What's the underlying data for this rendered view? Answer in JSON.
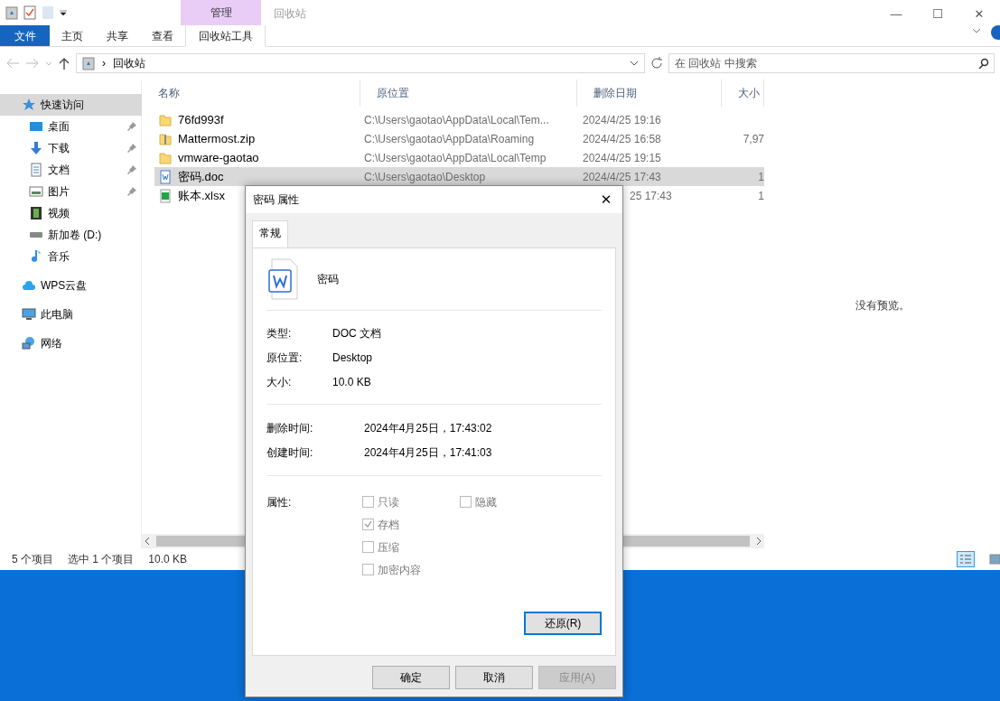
{
  "window": {
    "title": "回收站",
    "context_tab": "管理",
    "minimize": "—",
    "maximize": "☐",
    "close": "✕"
  },
  "ribbon_tabs": [
    {
      "label": "文件",
      "kind": "file",
      "selected": false
    },
    {
      "label": "主页",
      "kind": "plain",
      "selected": false
    },
    {
      "label": "共享",
      "kind": "plain",
      "selected": false
    },
    {
      "label": "查看",
      "kind": "plain",
      "selected": false
    },
    {
      "label": "回收站工具",
      "kind": "context",
      "selected": true
    }
  ],
  "address": {
    "crumb": "回收站",
    "separator": "›"
  },
  "search": {
    "placeholder": "在 回收站 中搜索"
  },
  "sidebar": [
    {
      "label": "快速访问",
      "selected": true,
      "children": [
        {
          "label": "桌面",
          "pinned": true
        },
        {
          "label": "下载",
          "pinned": true
        },
        {
          "label": "文档",
          "pinned": true
        },
        {
          "label": "图片",
          "pinned": true
        },
        {
          "label": "视频",
          "pinned": false
        },
        {
          "label": "新加卷 (D:)",
          "pinned": false
        },
        {
          "label": "音乐",
          "pinned": false
        }
      ]
    },
    {
      "label": "WPS云盘",
      "selected": false
    },
    {
      "label": "此电脑",
      "selected": false
    },
    {
      "label": "网络",
      "selected": false
    }
  ],
  "table": {
    "columns": [
      "名称",
      "原位置",
      "删除日期",
      "大小"
    ],
    "rows": [
      {
        "kind": "folder",
        "name": "76fd993f",
        "location": "C:\\Users\\gaotao\\AppData\\Local\\Tem...",
        "date": "2024/4/25 19:16",
        "selected": false
      },
      {
        "kind": "zip",
        "name": "Mattermost.zip",
        "location": "C:\\Users\\gaotao\\AppData\\Roaming",
        "date": "2024/4/25 16:58",
        "size": "7,97",
        "selected": false
      },
      {
        "kind": "folder",
        "name": "vmware-gaotao",
        "location": "C:\\Users\\gaotao\\AppData\\Local\\Temp",
        "date": "2024/4/25 19:15",
        "selected": false
      },
      {
        "kind": "doc",
        "name": "密码.doc",
        "location": "C:\\Users\\gaotao\\Desktop",
        "date": "2024/4/25 17:43",
        "size": "1",
        "selected": true
      },
      {
        "kind": "xlsx",
        "name": "账本.xlsx",
        "date": "25 17:43",
        "size": "1",
        "selected": false
      }
    ]
  },
  "preview": {
    "message": "没有预览。"
  },
  "status_bar": {
    "count": "5 个项目",
    "selection": "选中 1 个项目",
    "size": "10.0 KB"
  },
  "dialog": {
    "title": "密码 属性",
    "close": "✕",
    "tabs": [
      {
        "label": "常规",
        "selected": true
      }
    ],
    "file_name": "密码",
    "info": [
      {
        "label": "类型:",
        "value": "DOC 文档"
      },
      {
        "label": "原位置:",
        "value": "Desktop"
      },
      {
        "label": "大小:",
        "value": "10.0 KB"
      }
    ],
    "times": [
      {
        "label": "删除时间:",
        "value": "2024年4月25日，17:43:02"
      },
      {
        "label": "创建时间:",
        "value": "2024年4月25日，17:41:03"
      }
    ],
    "attributes_label": "属性:",
    "attributes": [
      {
        "label": "只读",
        "checked": false,
        "disabled": true
      },
      {
        "label": "隐藏",
        "checked": false,
        "disabled": true
      },
      {
        "label": "存档",
        "checked": true,
        "disabled": true
      },
      {
        "label": "压缩",
        "checked": false,
        "disabled": true
      },
      {
        "label": "加密内容",
        "checked": false,
        "disabled": true
      }
    ],
    "restore_button": "还原(R)",
    "buttons": [
      {
        "label": "确定",
        "disabled": false
      },
      {
        "label": "取消",
        "disabled": false
      },
      {
        "label": "应用(A)",
        "disabled": true
      }
    ]
  }
}
